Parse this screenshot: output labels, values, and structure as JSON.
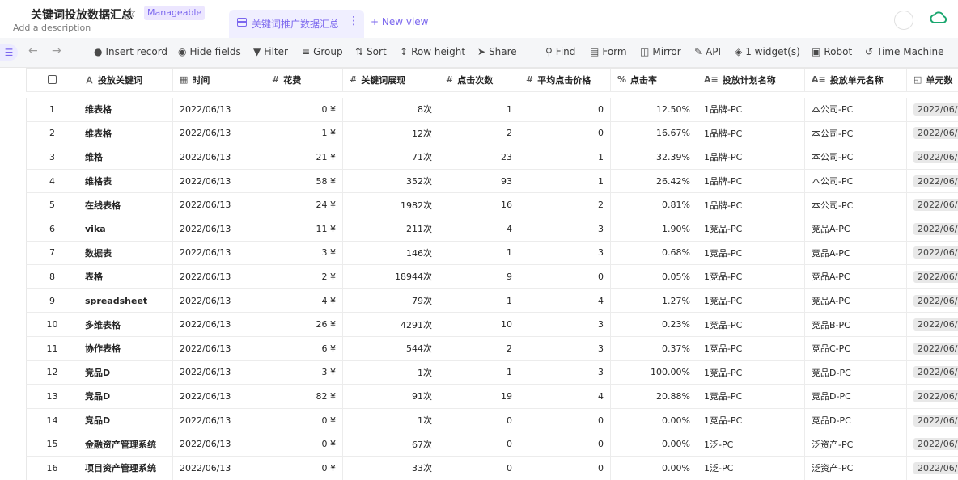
{
  "header": {
    "title": "关键词投放数据汇总",
    "badge": "Manageable",
    "description": "Add a description",
    "active_tab": "关键词推广数据汇总",
    "new_view": "+ New view"
  },
  "toolbar": {
    "insert_record": "Insert record",
    "hide_fields": "Hide fields",
    "filter": "Filter",
    "group": "Group",
    "sort": "Sort",
    "row_height": "Row height",
    "share": "Share",
    "find": "Find",
    "form": "Form",
    "mirror": "Mirror",
    "api": "API",
    "widgets": "1 widget(s)",
    "robot": "Robot",
    "time_machine": "Time Machine"
  },
  "columns": [
    "投放关键词",
    "时间",
    "花费",
    "关键词展现",
    "点击次数",
    "平均点击价格",
    "点击率",
    "投放计划名称",
    "投放单元名称",
    "单元数"
  ],
  "rows": [
    {
      "no": "1",
      "keyword": "维表格",
      "date": "2022/06/13",
      "cost": "0 ¥",
      "impr": "8次",
      "clicks": "1",
      "avg": "0",
      "ctr": "12.50%",
      "plan": "1品牌-PC",
      "unit": "本公司-PC",
      "u": "2022/06/"
    },
    {
      "no": "2",
      "keyword": "维表格",
      "date": "2022/06/13",
      "cost": "1 ¥",
      "impr": "12次",
      "clicks": "2",
      "avg": "0",
      "ctr": "16.67%",
      "plan": "1品牌-PC",
      "unit": "本公司-PC",
      "u": "2022/06/"
    },
    {
      "no": "3",
      "keyword": "维格",
      "date": "2022/06/13",
      "cost": "21 ¥",
      "impr": "71次",
      "clicks": "23",
      "avg": "1",
      "ctr": "32.39%",
      "plan": "1品牌-PC",
      "unit": "本公司-PC",
      "u": "2022/06/"
    },
    {
      "no": "4",
      "keyword": "维格表",
      "date": "2022/06/13",
      "cost": "58 ¥",
      "impr": "352次",
      "clicks": "93",
      "avg": "1",
      "ctr": "26.42%",
      "plan": "1品牌-PC",
      "unit": "本公司-PC",
      "u": "2022/06/"
    },
    {
      "no": "5",
      "keyword": "在线表格",
      "date": "2022/06/13",
      "cost": "24 ¥",
      "impr": "1982次",
      "clicks": "16",
      "avg": "2",
      "ctr": "0.81%",
      "plan": "1品牌-PC",
      "unit": "本公司-PC",
      "u": "2022/06/"
    },
    {
      "no": "6",
      "keyword": "vika",
      "date": "2022/06/13",
      "cost": "11 ¥",
      "impr": "211次",
      "clicks": "4",
      "avg": "3",
      "ctr": "1.90%",
      "plan": "1竞品-PC",
      "unit": "竞品A-PC",
      "u": "2022/06/"
    },
    {
      "no": "7",
      "keyword": "数据表",
      "date": "2022/06/13",
      "cost": "3 ¥",
      "impr": "146次",
      "clicks": "1",
      "avg": "3",
      "ctr": "0.68%",
      "plan": "1竞品-PC",
      "unit": "竞品A-PC",
      "u": "2022/06/"
    },
    {
      "no": "8",
      "keyword": "表格",
      "date": "2022/06/13",
      "cost": "2 ¥",
      "impr": "18944次",
      "clicks": "9",
      "avg": "0",
      "ctr": "0.05%",
      "plan": "1竞品-PC",
      "unit": "竞品A-PC",
      "u": "2022/06/"
    },
    {
      "no": "9",
      "keyword": "spreadsheet",
      "date": "2022/06/13",
      "cost": "4 ¥",
      "impr": "79次",
      "clicks": "1",
      "avg": "4",
      "ctr": "1.27%",
      "plan": "1竞品-PC",
      "unit": "竞品A-PC",
      "u": "2022/06/"
    },
    {
      "no": "10",
      "keyword": "多维表格",
      "date": "2022/06/13",
      "cost": "26 ¥",
      "impr": "4291次",
      "clicks": "10",
      "avg": "3",
      "ctr": "0.23%",
      "plan": "1竞品-PC",
      "unit": "竞品B-PC",
      "u": "2022/06/"
    },
    {
      "no": "11",
      "keyword": "协作表格",
      "date": "2022/06/13",
      "cost": "6 ¥",
      "impr": "544次",
      "clicks": "2",
      "avg": "3",
      "ctr": "0.37%",
      "plan": "1竞品-PC",
      "unit": "竞品C-PC",
      "u": "2022/06/"
    },
    {
      "no": "12",
      "keyword": "竞品D",
      "date": "2022/06/13",
      "cost": "3 ¥",
      "impr": "1次",
      "clicks": "1",
      "avg": "3",
      "ctr": "100.00%",
      "plan": "1竞品-PC",
      "unit": "竞品D-PC",
      "u": "2022/06/"
    },
    {
      "no": "13",
      "keyword": "竞品D",
      "date": "2022/06/13",
      "cost": "82 ¥",
      "impr": "91次",
      "clicks": "19",
      "avg": "4",
      "ctr": "20.88%",
      "plan": "1竞品-PC",
      "unit": "竞品D-PC",
      "u": "2022/06/"
    },
    {
      "no": "14",
      "keyword": "竞品D",
      "date": "2022/06/13",
      "cost": "0 ¥",
      "impr": "1次",
      "clicks": "0",
      "avg": "0",
      "ctr": "0.00%",
      "plan": "1竞品-PC",
      "unit": "竞品D-PC",
      "u": "2022/06/"
    },
    {
      "no": "15",
      "keyword": "金融资产管理系统",
      "date": "2022/06/13",
      "cost": "0 ¥",
      "impr": "67次",
      "clicks": "0",
      "avg": "0",
      "ctr": "0.00%",
      "plan": "1泛-PC",
      "unit": "泛资产-PC",
      "u": "2022/06/"
    },
    {
      "no": "16",
      "keyword": "项目资产管理系统",
      "date": "2022/06/13",
      "cost": "0 ¥",
      "impr": "33次",
      "clicks": "0",
      "avg": "0",
      "ctr": "0.00%",
      "plan": "1泛-PC",
      "unit": "泛资产-PC",
      "u": "2022/06/"
    }
  ]
}
